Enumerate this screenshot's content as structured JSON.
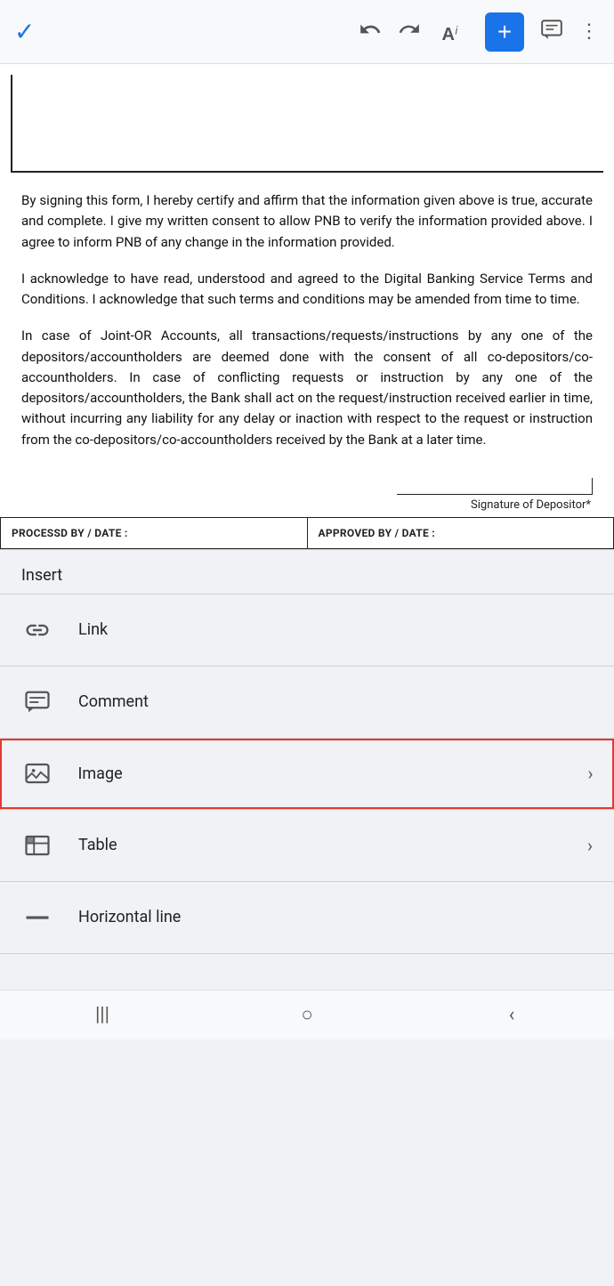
{
  "toolbar": {
    "check_label": "✓",
    "undo_label": "↺",
    "redo_label": "↻",
    "text_format_A": "A",
    "text_format_i": "i",
    "add_label": "+",
    "more_label": "⋮"
  },
  "document": {
    "paragraphs": [
      "By signing this form, I hereby certify and affirm that the information given above is true, accurate and complete. I give my written  consent to allow PNB to verify the information provided above. I agree to inform PNB of any change in the information provided.",
      "I acknowledge to have read, understood and agreed to the Digital Banking Service Terms and Conditions. I acknowledge that such  terms and conditions may be amended from time to time.",
      "In case of Joint-OR Accounts, all transactions/requests/instructions by any one of the depositors/accountholders are deemed done  with the consent of all co-depositors/co-accountholders. In case of conflicting requests or instruction by any one of the  depositors/accountholders, the Bank shall act on the request/instruction received earlier in time, without incurring any liability for  any delay or inaction with respect to the request or instruction  from the  co-depositors/co-accountholders received by the Bank at a  later time."
    ],
    "signature_label": "Signature of Depositor*",
    "processed_by": "PROCESSD BY / DATE :",
    "approved_by": "APPROVED BY / DATE :"
  },
  "insert_menu": {
    "title": "Insert",
    "items": [
      {
        "id": "link",
        "label": "Link",
        "has_arrow": false
      },
      {
        "id": "comment",
        "label": "Comment",
        "has_arrow": false
      },
      {
        "id": "image",
        "label": "Image",
        "has_arrow": true,
        "highlighted": true
      },
      {
        "id": "table",
        "label": "Table",
        "has_arrow": true
      },
      {
        "id": "horizontal-line",
        "label": "Horizontal line",
        "has_arrow": false
      }
    ]
  },
  "bottom_nav": {
    "items": [
      "|||",
      "○",
      "<"
    ]
  }
}
